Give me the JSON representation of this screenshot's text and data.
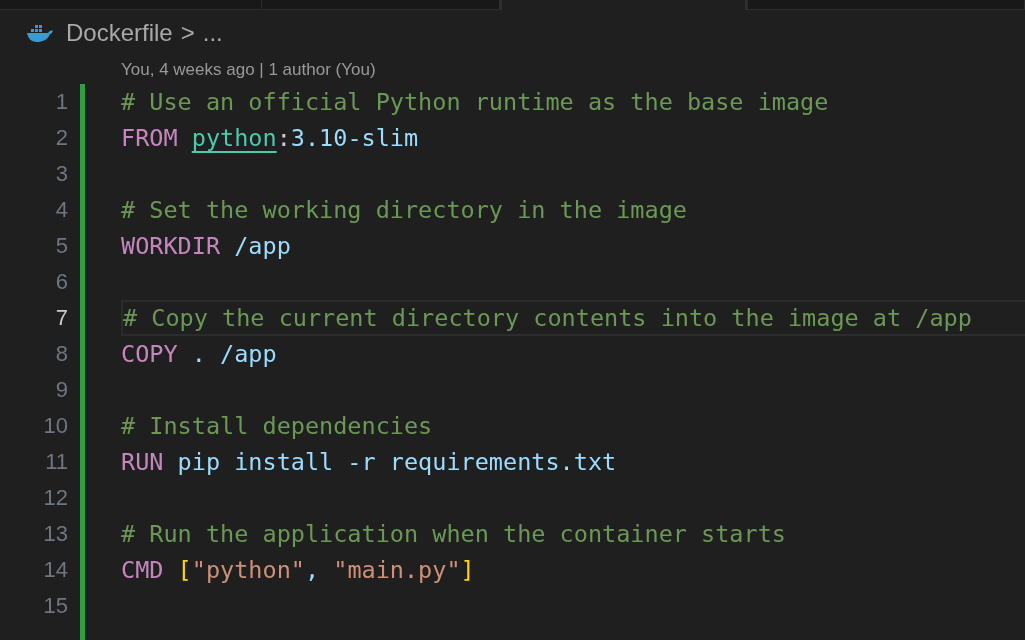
{
  "tabs": [
    {
      "selected": false
    },
    {
      "selected": false
    },
    {
      "selected": true
    },
    {
      "selected": false
    }
  ],
  "breadcrumb": {
    "file": "Dockerfile",
    "separator": ">",
    "more": "..."
  },
  "codelens": "You, 4 weeks ago | 1 author (You)",
  "lines": [
    {
      "number": "1",
      "current": false,
      "tokens": [
        {
          "kind": "comment",
          "text": "# Use an official Python runtime as the base image"
        }
      ]
    },
    {
      "number": "2",
      "current": false,
      "tokens": [
        {
          "kind": "keyword",
          "text": "FROM "
        },
        {
          "kind": "link",
          "text": "python"
        },
        {
          "kind": "plain",
          "text": ":"
        },
        {
          "kind": "value",
          "text": "3.10-slim"
        }
      ]
    },
    {
      "number": "3",
      "current": false
    },
    {
      "number": "4",
      "current": false,
      "tokens": [
        {
          "kind": "comment",
          "text": "# Set the working directory in the image"
        }
      ]
    },
    {
      "number": "5",
      "current": false,
      "tokens": [
        {
          "kind": "keyword",
          "text": "WORKDIR "
        },
        {
          "kind": "value",
          "text": "/app"
        }
      ]
    },
    {
      "number": "6",
      "current": false
    },
    {
      "number": "7",
      "current": true,
      "tokens": [
        {
          "kind": "comment",
          "text": "# Copy the current directory contents into the image at /app"
        }
      ]
    },
    {
      "number": "8",
      "current": false,
      "tokens": [
        {
          "kind": "keyword",
          "text": "COPY "
        },
        {
          "kind": "value",
          "text": ". /app"
        }
      ]
    },
    {
      "number": "9",
      "current": false
    },
    {
      "number": "10",
      "current": false,
      "tokens": [
        {
          "kind": "comment",
          "text": "# Install dependencies"
        }
      ]
    },
    {
      "number": "11",
      "current": false,
      "tokens": [
        {
          "kind": "keyword",
          "text": "RUN "
        },
        {
          "kind": "value",
          "text": "pip install -r requirements.txt"
        }
      ]
    },
    {
      "number": "12",
      "current": false
    },
    {
      "number": "13",
      "current": false,
      "tokens": [
        {
          "kind": "comment",
          "text": "# Run the application when the container starts"
        }
      ]
    },
    {
      "number": "14",
      "current": false,
      "tokens": [
        {
          "kind": "keyword",
          "text": "CMD "
        },
        {
          "kind": "bracket",
          "text": "["
        },
        {
          "kind": "string",
          "text": "\"python\""
        },
        {
          "kind": "value",
          "text": ", "
        },
        {
          "kind": "string",
          "text": "\"main.py\""
        },
        {
          "kind": "bracket",
          "text": "]"
        }
      ]
    },
    {
      "number": "15",
      "current": false
    }
  ]
}
